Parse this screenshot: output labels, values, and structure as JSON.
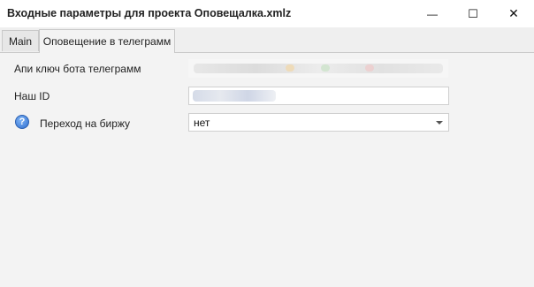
{
  "window": {
    "title": "Входные параметры для проекта Оповещалка.xmlz",
    "controls": {
      "minimize": "—",
      "maximize": "☐",
      "close": "✕"
    }
  },
  "tabs": [
    {
      "label": "Main",
      "active": false
    },
    {
      "label": "Оповещение в телеграмм",
      "active": true
    }
  ],
  "form": {
    "api_key": {
      "label": "Апи ключ бота телеграмм",
      "value": ""
    },
    "our_id": {
      "label": "Наш ID",
      "value": ""
    },
    "exchange": {
      "label": "Переход на биржу",
      "value": "нет",
      "help_icon": "question-mark-help-icon"
    }
  }
}
